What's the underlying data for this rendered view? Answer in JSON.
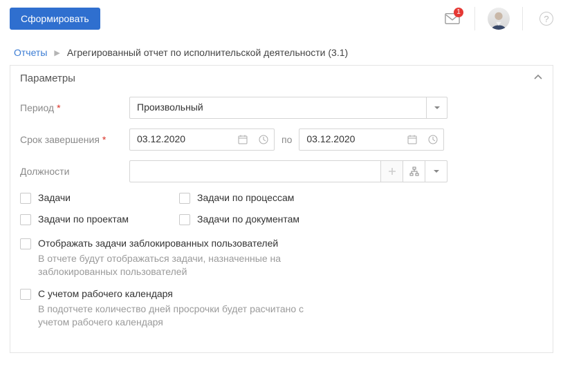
{
  "topbar": {
    "generate_label": "Сформировать",
    "notif_count": "1"
  },
  "breadcrumb": {
    "root": "Отчеты",
    "current": "Агрегированный отчет по исполнительской деятельности (3.1)"
  },
  "panel": {
    "title": "Параметры"
  },
  "form": {
    "period_label": "Период",
    "period_value": "Произвольный",
    "deadline_label": "Срок завершения",
    "deadline_from": "03.12.2020",
    "deadline_sep": "по",
    "deadline_to": "03.12.2020",
    "positions_label": "Должности"
  },
  "checks": {
    "tasks": "Задачи",
    "tasks_process": "Задачи по процессам",
    "tasks_projects": "Задачи по проектам",
    "tasks_documents": "Задачи по документам",
    "blocked_title": "Отображать задачи заблокированных пользователей",
    "blocked_desc": "В отчете будут отображаться задачи, назначенные на заблокированных пользователей",
    "calendar_title": "С учетом рабочего календаря",
    "calendar_desc": "В подотчете количество дней просрочки будет расчитано с учетом рабочего календаря"
  }
}
